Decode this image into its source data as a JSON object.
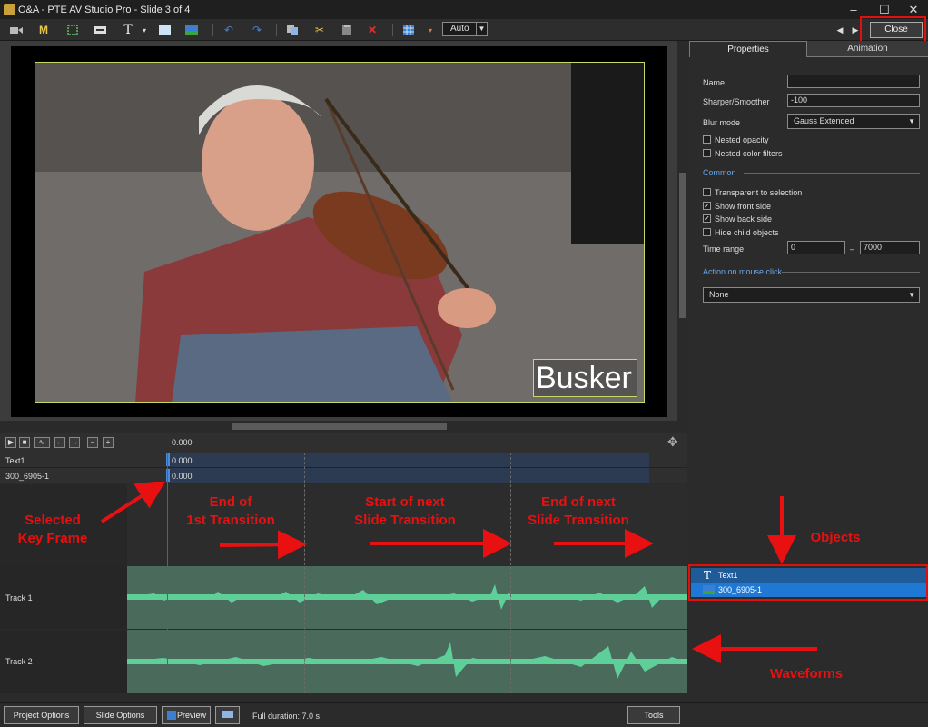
{
  "window": {
    "title": "O&A - PTE AV Studio Pro - Slide 3 of 4",
    "minimize": "–",
    "maximize": "☐",
    "close": "✕"
  },
  "toolbar": {
    "zoom_value": "Auto",
    "close_label": "Close"
  },
  "stage": {
    "caption": "Busker"
  },
  "properties": {
    "tabs": [
      "Properties",
      "Animation"
    ],
    "name_label": "Name",
    "name_value": "",
    "sharper_label": "Sharper/Smoother",
    "sharper_value": "-100",
    "blur_label": "Blur mode",
    "blur_value": "Gauss Extended",
    "nested_opacity": "Nested opacity",
    "nested_color": "Nested color filters",
    "common_section": "Common",
    "transparent": "Transparent to selection",
    "show_front": "Show front side",
    "show_back": "Show back side",
    "hide_child": "Hide child objects",
    "time_range_label": "Time range",
    "time_from": "0",
    "time_dash": "–",
    "time_to": "7000",
    "mouse_section": "Action on mouse click",
    "mouse_value": "None"
  },
  "objects": {
    "items": [
      "Text1",
      "300_6905-1"
    ]
  },
  "timeline": {
    "time_label": "0.000",
    "tracks": [
      {
        "name": "Text1",
        "time": "0.000"
      },
      {
        "name": "300_6905-1",
        "time": "0.000"
      }
    ],
    "audio_tracks": [
      "Track 1",
      "Track 2"
    ]
  },
  "annotations": {
    "selected_kf": "Selected\nKey Frame",
    "end_first": "End of\n1st Transition",
    "start_next": "Start of next\nSlide Transition",
    "end_next": "End of next\nSlide Transition",
    "objects": "Objects",
    "waveforms": "Waveforms"
  },
  "statusbar": {
    "project_options": "Project Options",
    "slide_options": "Slide Options",
    "preview": "Preview",
    "duration": "Full duration: 7.0 s",
    "tools": "Tools"
  },
  "colors": {
    "accent": "#e81010",
    "selected": "#1e78d4",
    "waveform": "#5fcf9a"
  }
}
